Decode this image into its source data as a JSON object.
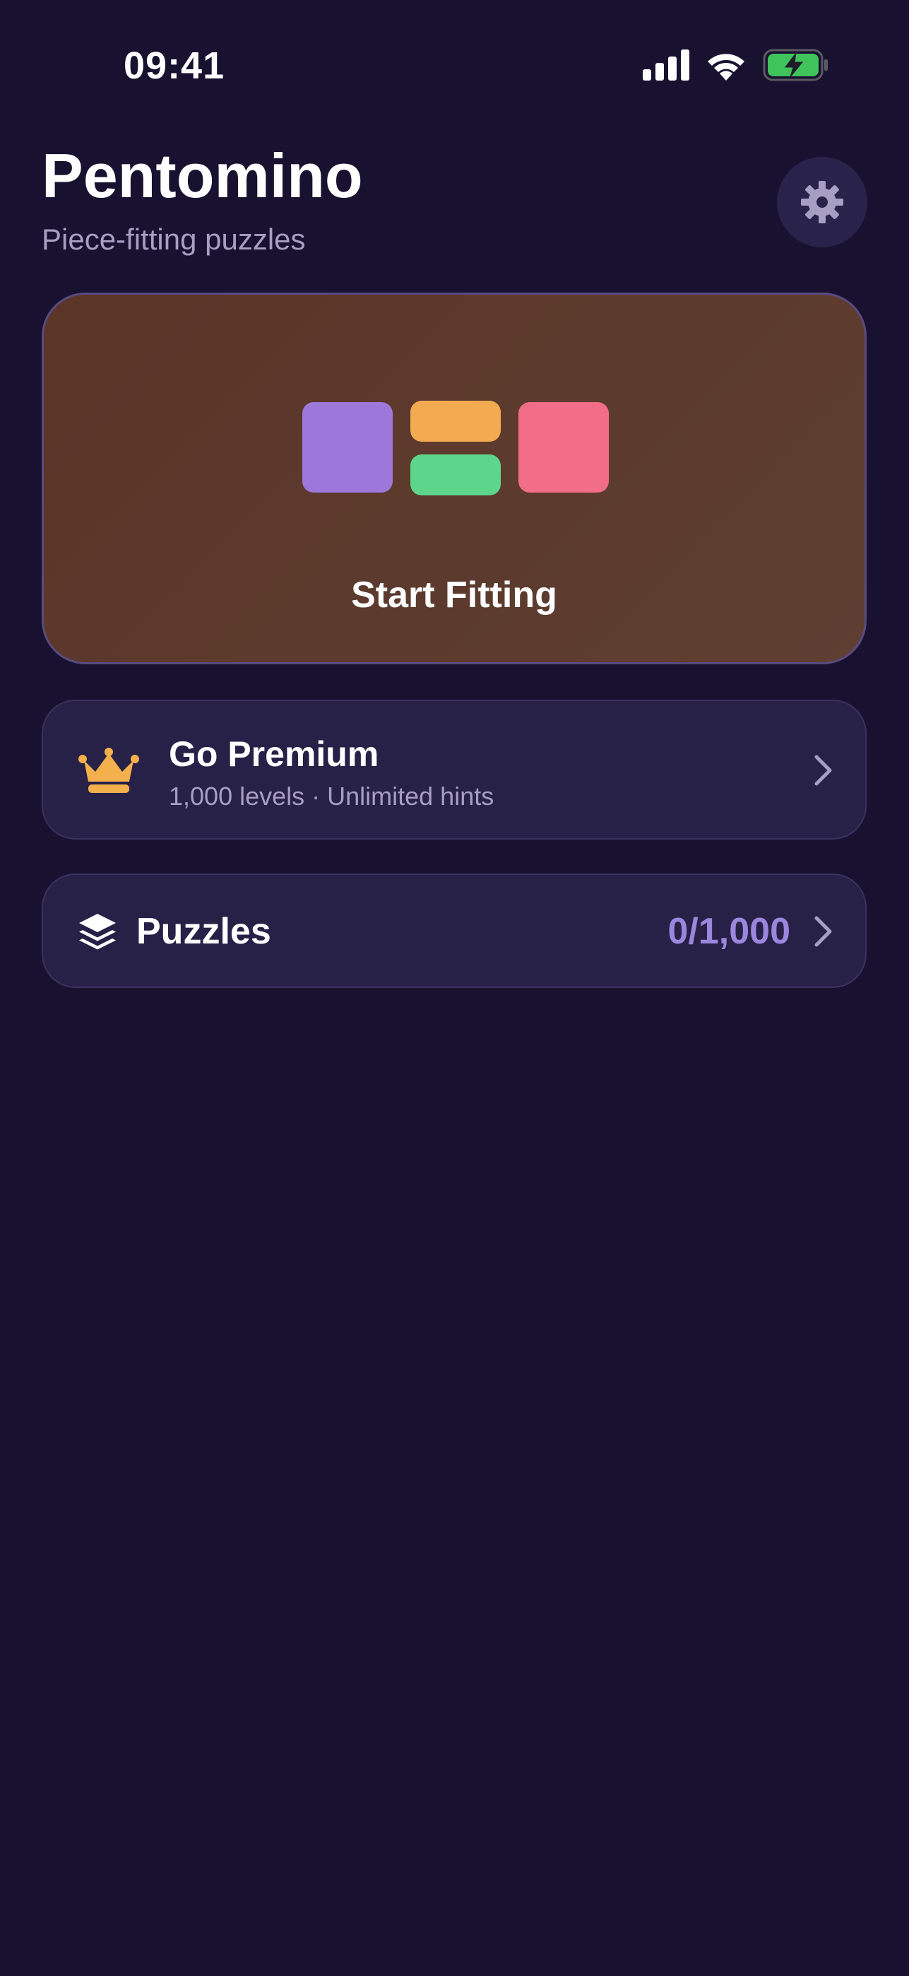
{
  "status_bar": {
    "time": "09:41",
    "icons": [
      "cellular-signal-icon",
      "wifi-icon",
      "battery-charging-icon"
    ]
  },
  "header": {
    "title": "Pentomino",
    "subtitle": "Piece-fitting puzzles",
    "settings_icon": "gear-icon"
  },
  "start_card": {
    "label": "Start Fitting",
    "piece_colors": [
      "#9d78da",
      "#f2ab50",
      "#5dd68b",
      "#f26e88"
    ]
  },
  "premium": {
    "icon": "crown-icon",
    "title": "Go Premium",
    "subtitle": "1,000 levels · Unlimited hints"
  },
  "puzzles": {
    "icon": "layers-icon",
    "title": "Puzzles",
    "count": "0/1,000"
  },
  "colors": {
    "background": "#181230",
    "card": "#272047",
    "accent_purple": "#9b86de",
    "crown_gold": "#f5b04e",
    "subtitle_text": "#a79fc3"
  }
}
